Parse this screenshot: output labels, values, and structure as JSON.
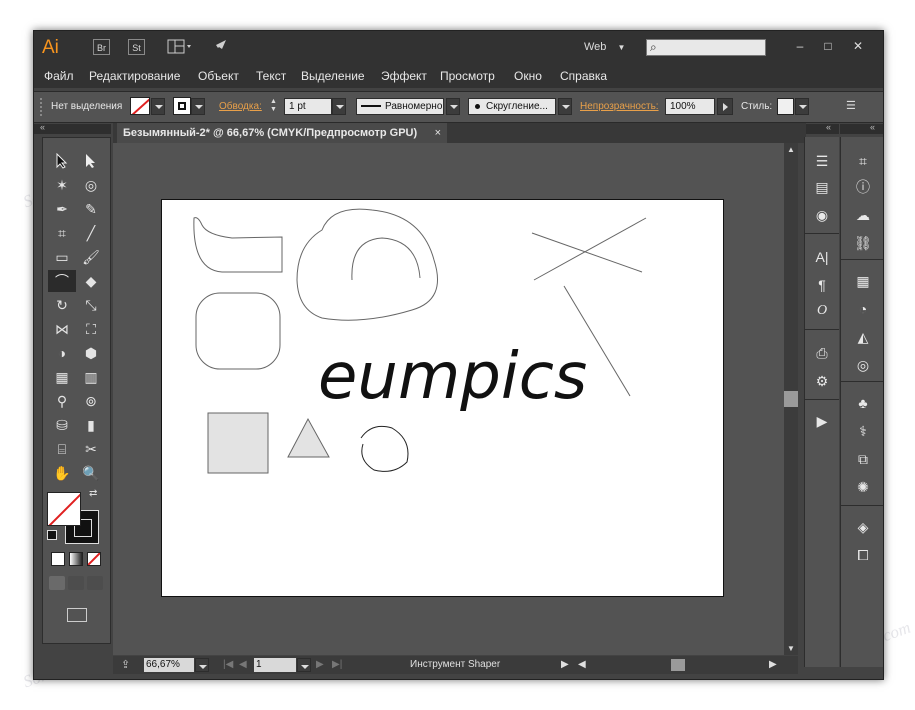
{
  "app": {
    "logo": "Ai",
    "bridge_btn": "Br",
    "stock_btn": "St",
    "workspace": "Web",
    "window_controls": [
      "minimize-icon",
      "maximize-icon",
      "close-icon"
    ]
  },
  "menu": [
    "Файл",
    "Редактирование",
    "Объект",
    "Текст",
    "Выделение",
    "Эффект",
    "Просмотр",
    "Окно",
    "Справка"
  ],
  "control_bar": {
    "selection": "Нет выделения",
    "stroke_label": "Обводка:",
    "stroke_weight": "1 pt",
    "stroke_profile": "Равномерно",
    "brush": "Скругление...",
    "opacity_label": "Непрозрачность:",
    "opacity_value": "100%",
    "style_label": "Стиль:"
  },
  "document": {
    "tab_title": "Безымянный-2* @ 66,67% (CMYK/Предпросмотр GPU)",
    "tab_close": "×",
    "artwork_text": "eumpics"
  },
  "status_bar": {
    "zoom": "66,67%",
    "artboard": "1",
    "tool": "Инструмент Shaper"
  },
  "watermark": "Soringpcrepair.com",
  "colors": {
    "accent": "#f7941e",
    "window_bg": "#434343",
    "panel_bg": "#535353",
    "label_orange": "#e8a04a"
  }
}
